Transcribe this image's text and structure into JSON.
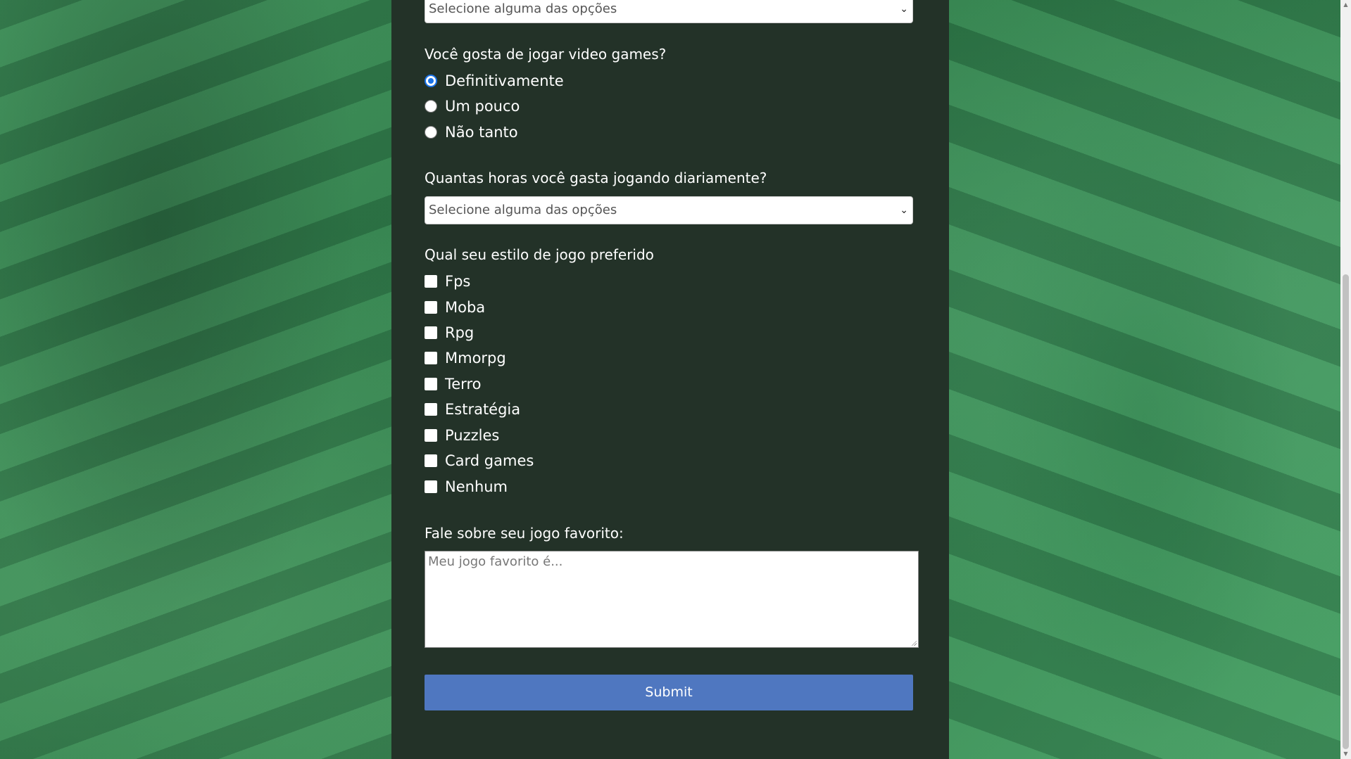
{
  "top_select": {
    "value": "Selecione alguma das opções"
  },
  "q_games": {
    "label": "Você gosta de jogar video games?",
    "options": [
      "Definitivamente",
      "Um pouco",
      "Não tanto"
    ],
    "selected": "Definitivamente"
  },
  "q_hours": {
    "label": "Quantas horas você gasta jogando diariamente?",
    "select_value": "Selecione alguma das opções"
  },
  "q_style": {
    "label": "Qual seu estilo de jogo preferido",
    "options": [
      "Fps",
      "Moba",
      "Rpg",
      "Mmorpg",
      "Terro",
      "Estratégia",
      "Puzzles",
      "Card games",
      "Nenhum"
    ]
  },
  "q_favorite": {
    "label": "Fale sobre seu jogo favorito:",
    "placeholder": "Meu jogo favorito é..."
  },
  "submit_label": "Submit",
  "colors": {
    "panel": "#233228",
    "submit": "#4f77c0",
    "radio_accent": "#1a73e8",
    "background": "#3f8f5a"
  },
  "icons": {
    "select_arrow": "chevron-down-icon"
  }
}
